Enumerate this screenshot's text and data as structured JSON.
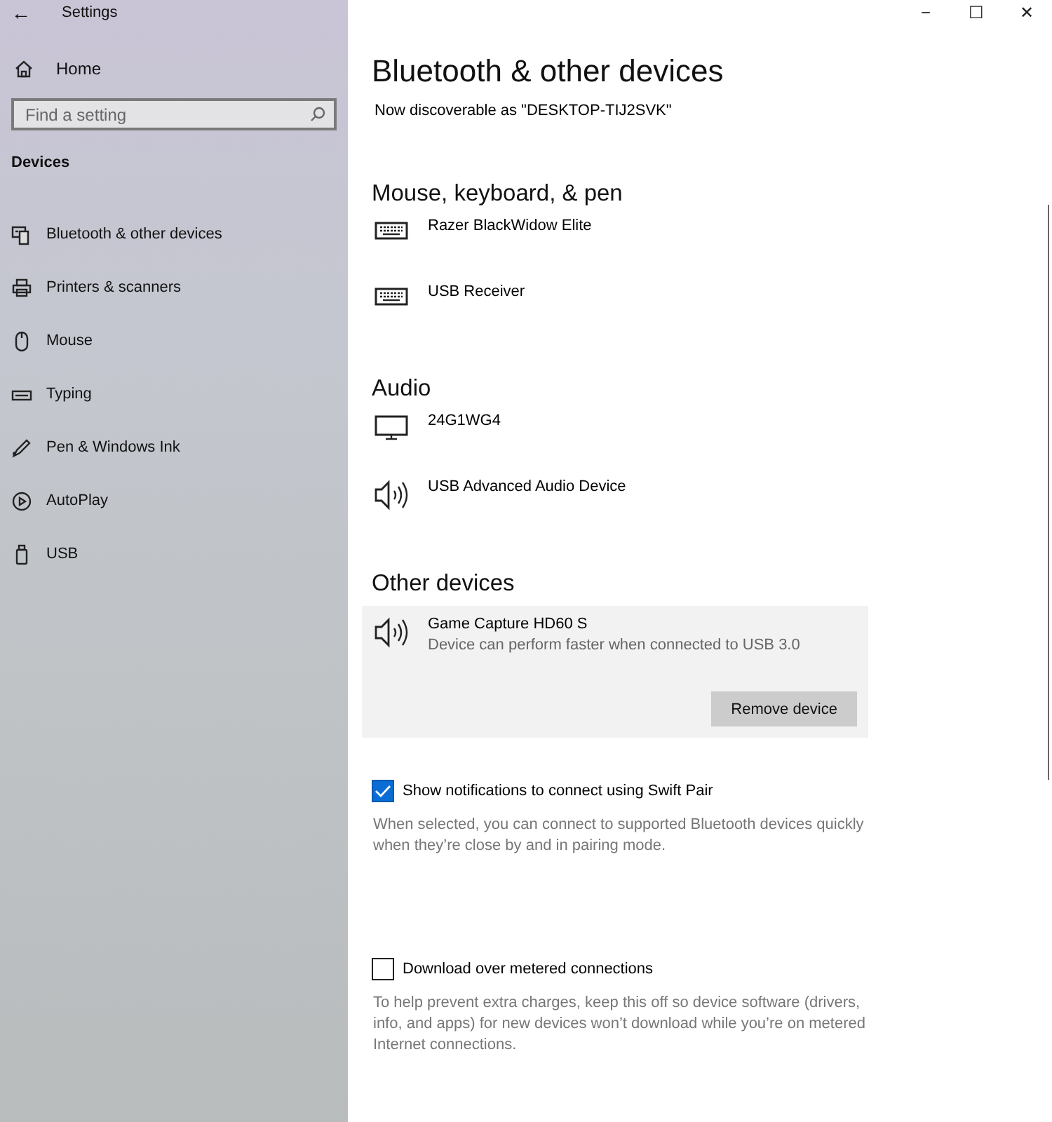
{
  "window": {
    "title": "Settings",
    "back": "←",
    "controls": [
      "−",
      "☐",
      "✕"
    ]
  },
  "sidebar": {
    "home": "Home",
    "search": {
      "placeholder": "Find a setting"
    },
    "section": "Devices",
    "items": [
      {
        "label": "Bluetooth & other devices"
      },
      {
        "label": "Printers & scanners"
      },
      {
        "label": "Mouse"
      },
      {
        "label": "Typing"
      },
      {
        "label": "Pen & Windows Ink"
      },
      {
        "label": "AutoPlay"
      },
      {
        "label": "USB"
      }
    ]
  },
  "main": {
    "title": "Bluetooth & other devices",
    "discoverable": "Now discoverable as \"DESKTOP-TIJ2SVK\"",
    "groups": [
      {
        "heading": "Mouse, keyboard, & pen",
        "devices": [
          {
            "kind": "keyboard",
            "name": "Razer BlackWidow Elite"
          },
          {
            "kind": "keyboard",
            "name": "USB Receiver"
          }
        ]
      },
      {
        "heading": "Audio",
        "devices": [
          {
            "kind": "monitor",
            "name": "24G1WG4"
          },
          {
            "kind": "speaker",
            "name": "USB Advanced Audio Device"
          }
        ]
      },
      {
        "heading": "Other devices",
        "devices": [
          {
            "kind": "speaker",
            "name": "Game Capture HD60 S",
            "status": "Device can perform faster when connected to USB 3.0",
            "expanded": true,
            "button": "Remove device"
          }
        ]
      }
    ],
    "options": [
      {
        "label": "Show notifications to connect using Swift Pair",
        "checked": true,
        "description": "When selected, you can connect to supported Bluetooth devices quickly when they’re close by and in pairing mode."
      },
      {
        "label": "Download over metered connections",
        "checked": false,
        "description": "To help prevent extra charges, keep this off so device software (drivers, info, and apps) for new devices won’t download while you’re on metered Internet connections."
      }
    ]
  }
}
